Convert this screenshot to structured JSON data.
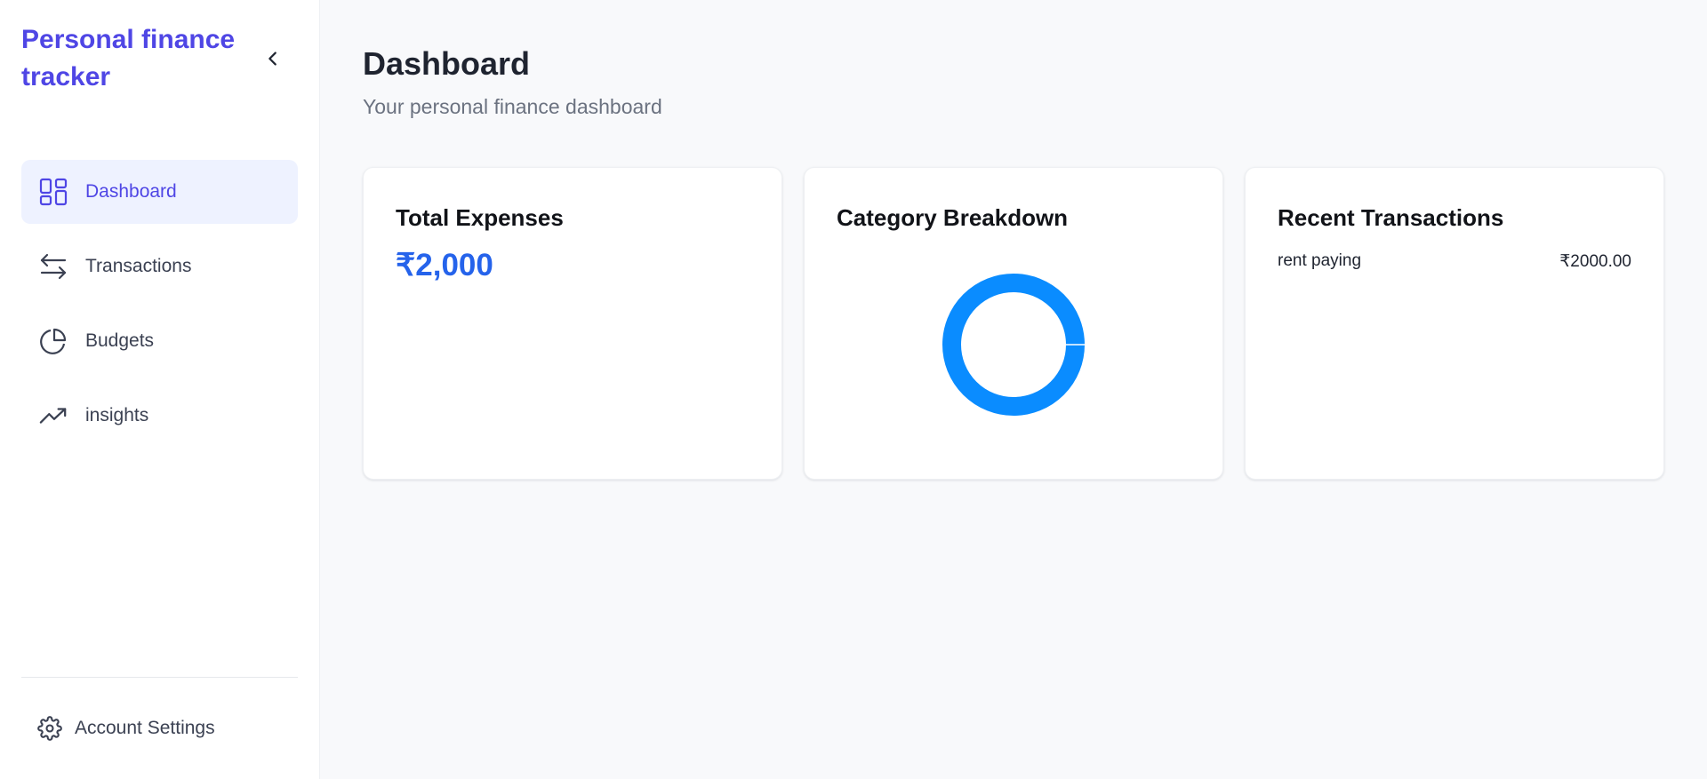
{
  "sidebar": {
    "brand": "Personal finance tracker",
    "items": [
      {
        "label": "Dashboard",
        "icon": "dashboard-grid-icon",
        "active": true
      },
      {
        "label": "Transactions",
        "icon": "arrows-swap-icon",
        "active": false
      },
      {
        "label": "Budgets",
        "icon": "pie-chart-icon",
        "active": false
      },
      {
        "label": "insights",
        "icon": "trending-up-icon",
        "active": false
      }
    ],
    "settings_label": "Account Settings"
  },
  "header": {
    "title": "Dashboard",
    "subtitle": "Your personal finance dashboard"
  },
  "cards": {
    "total_expenses": {
      "title": "Total Expenses",
      "value": "₹2,000"
    },
    "category_breakdown": {
      "title": "Category Breakdown"
    },
    "recent_transactions": {
      "title": "Recent Transactions",
      "items": [
        {
          "description": "rent paying",
          "amount": "₹2000.00"
        }
      ]
    }
  },
  "colors": {
    "brand": "#4f46e5",
    "accent_value": "#2563eb",
    "donut": "#0a8cff"
  },
  "chart_data": {
    "type": "pie",
    "donut": true,
    "categories": [
      ""
    ],
    "values": [
      2000
    ],
    "colors": [
      "#0a8cff"
    ],
    "title": ""
  }
}
